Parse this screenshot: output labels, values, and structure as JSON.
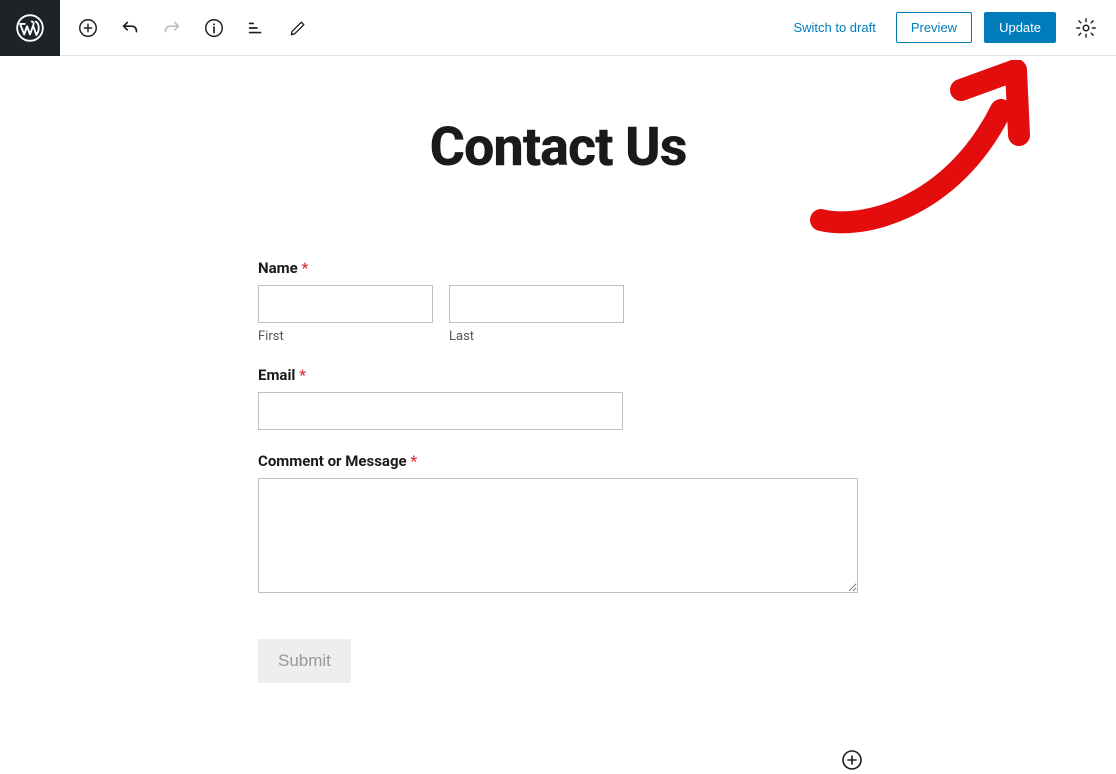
{
  "topbar": {
    "switch_draft": "Switch to draft",
    "preview": "Preview",
    "update": "Update"
  },
  "page": {
    "title": "Contact Us"
  },
  "form": {
    "name_label": "Name",
    "first_sub": "First",
    "last_sub": "Last",
    "email_label": "Email",
    "comment_label": "Comment or Message",
    "submit_label": "Submit",
    "required_marker": "*"
  }
}
